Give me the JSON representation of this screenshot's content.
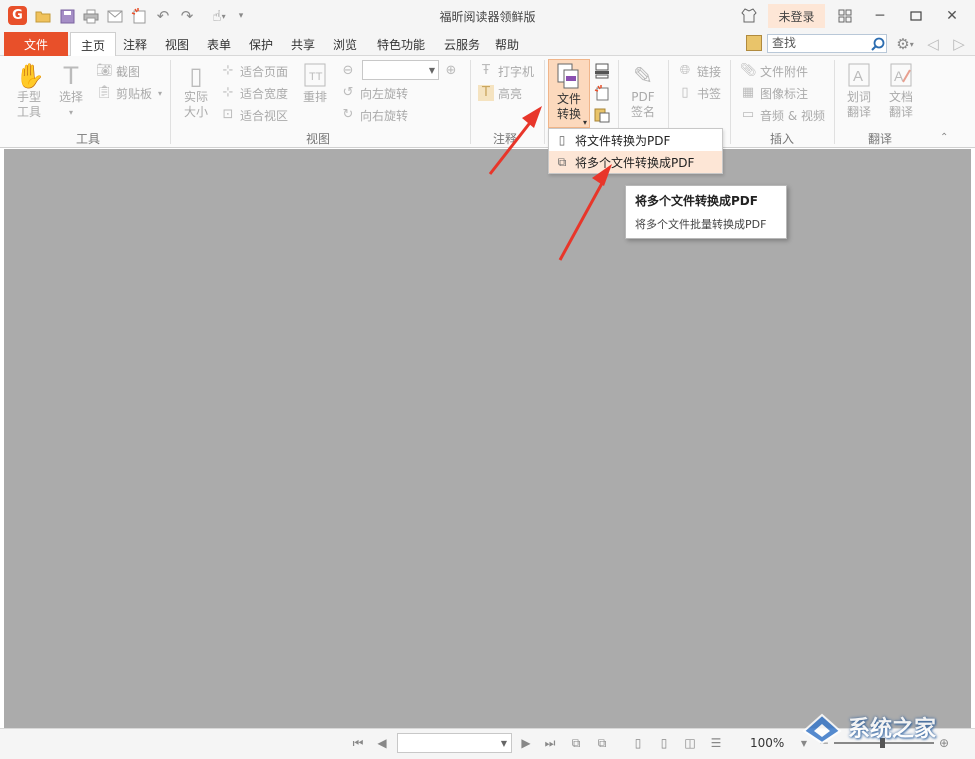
{
  "window": {
    "title": "福昕阅读器领鲜版",
    "login_label": "未登录"
  },
  "menubar": {
    "file_label": "文件",
    "tabs": [
      {
        "label": "主页",
        "active": true
      },
      {
        "label": "注释"
      },
      {
        "label": "视图"
      },
      {
        "label": "表单"
      },
      {
        "label": "保护"
      },
      {
        "label": "共享"
      },
      {
        "label": "浏览"
      },
      {
        "label": "特色功能"
      },
      {
        "label": "云服务"
      },
      {
        "label": "帮助"
      }
    ],
    "search_placeholder": "查找"
  },
  "ribbon": {
    "hand_tool": "手型\n工具",
    "select_tool": "选择",
    "screenshot": "截图",
    "clipboard": "剪贴板",
    "group_tools": "工具",
    "actual_size": "实际\n大小",
    "fit_page": "适合页面",
    "fit_width": "适合宽度",
    "fit_visible": "适合视区",
    "reflow": "重排",
    "rotate_left": "向左旋转",
    "rotate_right": "向右旋转",
    "group_view": "视图",
    "typewriter": "打字机",
    "highlight": "高亮",
    "group_comment": "注释",
    "file_convert": "文件\n转换",
    "pdf_sign": "PDF\n签名",
    "link": "链接",
    "bookmark": "书签",
    "file_attachment": "文件附件",
    "image_annotation": "图像标注",
    "audio_video": "音频 & 视频",
    "group_insert": "插入",
    "word_translate": "划词\n翻译",
    "doc_translate": "文档\n翻译",
    "group_translate": "翻译"
  },
  "convert_menu": {
    "items": [
      {
        "label": "将文件转换为PDF"
      },
      {
        "label": "将多个文件转换成PDF",
        "hover": true
      }
    ]
  },
  "tooltip": {
    "title": "将多个文件转换成PDF",
    "description": "将多个文件批量转换成PDF"
  },
  "statusbar": {
    "zoom": "100%"
  },
  "watermark": {
    "text": "系统之家"
  },
  "colors": {
    "accent": "#e8502a",
    "highlight": "#fcd9bd",
    "doc_background": "#ababab",
    "annotation_arrow": "#e8362a"
  }
}
